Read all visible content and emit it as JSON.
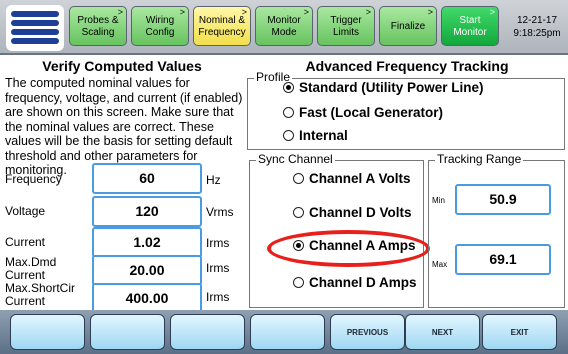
{
  "header": {
    "tabs": [
      {
        "label": "Probes &\nScaling",
        "state": "normal"
      },
      {
        "label": "Wiring\nConfig",
        "state": "normal"
      },
      {
        "label": "Nominal &\nFrequency",
        "state": "active"
      },
      {
        "label": "Monitor\nMode",
        "state": "normal"
      },
      {
        "label": "Trigger\nLimits",
        "state": "normal"
      },
      {
        "label": "Finalize",
        "state": "normal"
      },
      {
        "label": "Start\nMonitor",
        "state": "start"
      }
    ],
    "date": "12-21-17",
    "time": "9:18:25pm"
  },
  "left_panel": {
    "title": "Verify Computed Values",
    "description": "The computed nominal values for frequency, voltage, and current (if enabled) are shown on this screen. Make sure that the nominal values are correct. These values will be the basis for setting default threshold and other parameters for monitoring.",
    "rows": [
      {
        "label": "Frequency",
        "value": "60",
        "unit": "Hz"
      },
      {
        "label": "Voltage",
        "value": "120",
        "unit": "Vrms"
      },
      {
        "label": "Current",
        "value": "1.02",
        "unit": "Irms"
      },
      {
        "label": "Max.Dmd\nCurrent",
        "value": "20.00",
        "unit": "Irms"
      },
      {
        "label": "Max.ShortCir\nCurrent",
        "value": "400.00",
        "unit": "Irms"
      }
    ]
  },
  "right_panel": {
    "title": "Advanced Frequency Tracking",
    "profile": {
      "label": "Profile",
      "options": [
        "Standard (Utility Power Line)",
        "Fast (Local Generator)",
        "Internal"
      ],
      "selected_index": 0
    },
    "sync_channel": {
      "label": "Sync Channel",
      "options": [
        "Channel A Volts",
        "Channel D Volts",
        "Channel A Amps",
        "Channel D Amps"
      ],
      "selected_index": 2
    },
    "tracking_range": {
      "label": "Tracking Range",
      "min_label": "Min",
      "min_value": "50.9",
      "max_label": "Max",
      "max_value": "69.1"
    }
  },
  "footer": {
    "buttons": [
      "",
      "",
      "",
      "",
      "PREVIOUS",
      "NEXT",
      "EXIT"
    ]
  },
  "colors": {
    "tab_green": "#67c35f",
    "tab_active_yellow": "#f1df4a",
    "start_green": "#12a83c",
    "field_border": "#4b9be0",
    "highlight_red": "#e8201c",
    "fkey_blue": "#9fd7f2"
  }
}
